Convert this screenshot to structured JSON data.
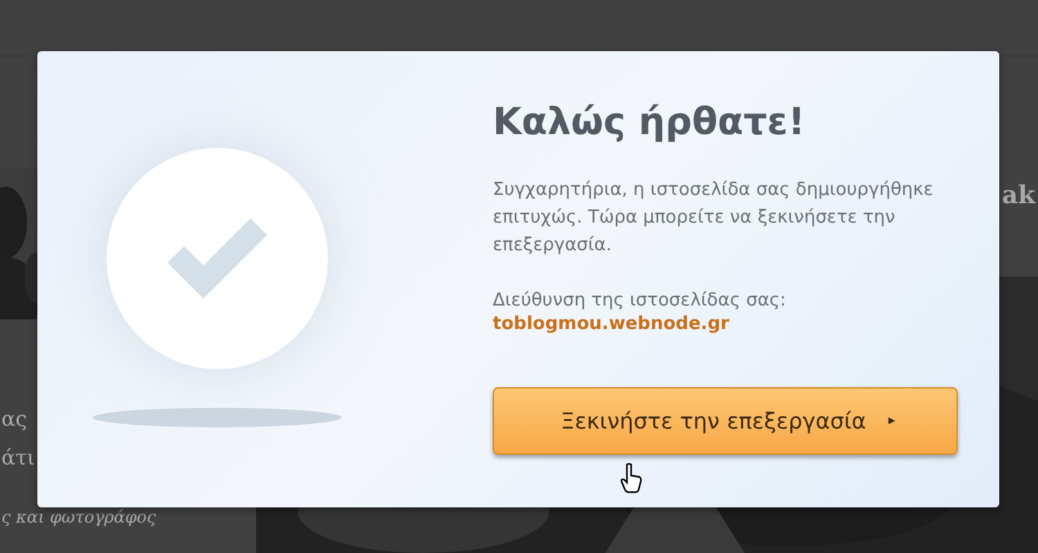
{
  "background": {
    "sidebar_texts": [
      "ας",
      "άτι"
    ],
    "sidebar_caption": "ς και φωτογράφος",
    "heading_fragment": "ak"
  },
  "dialog": {
    "title": "Καλώς ήρθατε!",
    "message": "Συγχαρητήρια, η ιστοσελίδα σας δημιουργήθηκε επιτυχώς. Τώρα μπορείτε να ξεκινήσετε την επεξεργασία.",
    "address_label": "Διεύθυνση της ιστοσελίδας σας:",
    "address_link": "toblogmou.webnode.gr",
    "button": {
      "label": "Ξεκινήστε την επεξεργασία",
      "arrow": "▸"
    }
  }
}
